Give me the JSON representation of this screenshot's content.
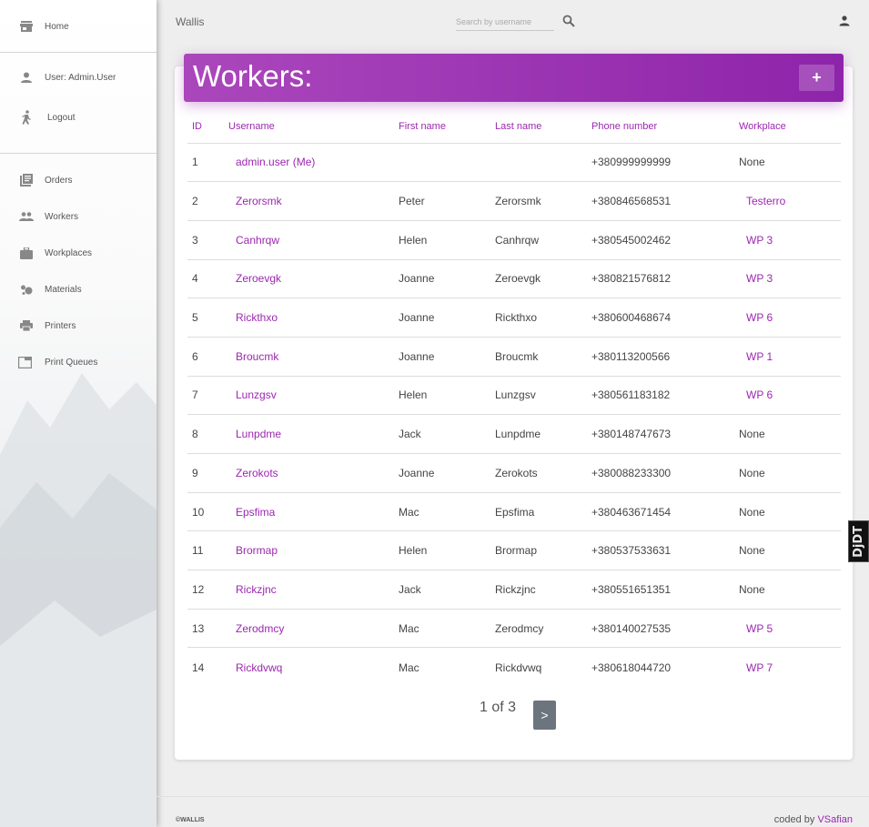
{
  "app": {
    "brand": "Wallis"
  },
  "sidebar": {
    "items": [
      {
        "label": "Home",
        "icon": "store-icon"
      },
      {
        "label": "User: Admin.User",
        "icon": "person-icon"
      },
      {
        "label": "Logout",
        "icon": "walk-icon"
      },
      {
        "label": "Orders",
        "icon": "library-books-icon"
      },
      {
        "label": "Workers",
        "icon": "people-icon"
      },
      {
        "label": "Workplaces",
        "icon": "briefcase-icon"
      },
      {
        "label": "Materials",
        "icon": "bubble-chart-icon"
      },
      {
        "label": "Printers",
        "icon": "printer-icon"
      },
      {
        "label": "Print Queues",
        "icon": "tab-icon"
      }
    ]
  },
  "search": {
    "placeholder": "Search by username"
  },
  "card": {
    "title": "Workers:",
    "add_label": "+"
  },
  "table": {
    "headers": [
      "ID",
      "Username",
      "First name",
      "Last name",
      "Phone number",
      "Workplace"
    ],
    "rows": [
      {
        "id": "1",
        "username": "admin.user (Me)",
        "first": "",
        "last": "",
        "phone": "+380999999999",
        "workplace": "None"
      },
      {
        "id": "2",
        "username": "Zerorsmk",
        "first": "Peter",
        "last": "Zerorsmk",
        "phone": "+380846568531",
        "workplace": "Testerro"
      },
      {
        "id": "3",
        "username": "Canhrqw",
        "first": "Helen",
        "last": "Canhrqw",
        "phone": "+380545002462",
        "workplace": "WP 3"
      },
      {
        "id": "4",
        "username": "Zeroevgk",
        "first": "Joanne",
        "last": "Zeroevgk",
        "phone": "+380821576812",
        "workplace": "WP 3"
      },
      {
        "id": "5",
        "username": "Rickthxo",
        "first": "Joanne",
        "last": "Rickthxo",
        "phone": "+380600468674",
        "workplace": "WP 6"
      },
      {
        "id": "6",
        "username": "Broucmk",
        "first": "Joanne",
        "last": "Broucmk",
        "phone": "+380113200566",
        "workplace": "WP 1"
      },
      {
        "id": "7",
        "username": "Lunzgsv",
        "first": "Helen",
        "last": "Lunzgsv",
        "phone": "+380561183182",
        "workplace": "WP 6"
      },
      {
        "id": "8",
        "username": "Lunpdme",
        "first": "Jack",
        "last": "Lunpdme",
        "phone": "+380148747673",
        "workplace": "None"
      },
      {
        "id": "9",
        "username": "Zerokots",
        "first": "Joanne",
        "last": "Zerokots",
        "phone": "+380088233300",
        "workplace": "None"
      },
      {
        "id": "10",
        "username": "Epsfima",
        "first": "Mac",
        "last": "Epsfima",
        "phone": "+380463671454",
        "workplace": "None"
      },
      {
        "id": "11",
        "username": "Brormap",
        "first": "Helen",
        "last": "Brormap",
        "phone": "+380537533631",
        "workplace": "None"
      },
      {
        "id": "12",
        "username": "Rickzjnc",
        "first": "Jack",
        "last": "Rickzjnc",
        "phone": "+380551651351",
        "workplace": "None"
      },
      {
        "id": "13",
        "username": "Zerodmcy",
        "first": "Mac",
        "last": "Zerodmcy",
        "phone": "+380140027535",
        "workplace": "WP 5"
      },
      {
        "id": "14",
        "username": "Rickdvwq",
        "first": "Mac",
        "last": "Rickdvwq",
        "phone": "+380618044720",
        "workplace": "WP 7"
      }
    ]
  },
  "pagination": {
    "text": "1 of 3",
    "next_label": ">"
  },
  "footer": {
    "copyright": "©WALLIS",
    "coded_by": "coded by",
    "author": "VSafian"
  },
  "debug_toolbar": {
    "label": "DjDT"
  },
  "colors": {
    "accent": "#9c27b0",
    "header_gradient_start": "#ab47bc",
    "header_gradient_end": "#8e24aa"
  }
}
